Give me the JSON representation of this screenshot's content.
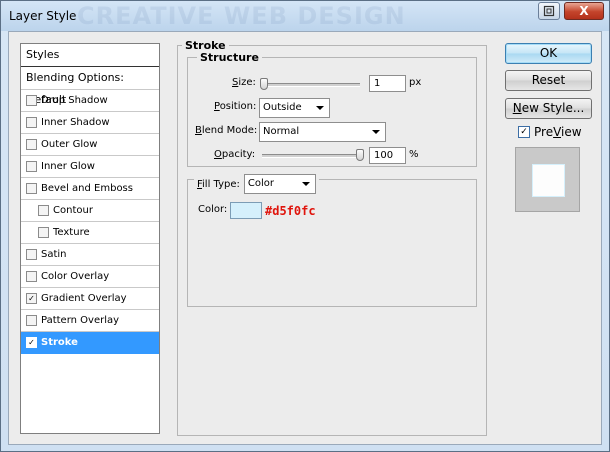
{
  "window": {
    "title": "Layer Style",
    "watermark": "CREATIVE WEB DESIGN",
    "help_glyph": "?",
    "close_glyph": "X"
  },
  "styles_list": {
    "header": "Styles",
    "blending": "Blending Options: Default",
    "items": [
      {
        "label": "Drop Shadow",
        "checked": false
      },
      {
        "label": "Inner Shadow",
        "checked": false
      },
      {
        "label": "Outer Glow",
        "checked": false
      },
      {
        "label": "Inner Glow",
        "checked": false
      },
      {
        "label": "Bevel and Emboss",
        "checked": false
      },
      {
        "label": "Contour",
        "checked": false,
        "sub": true
      },
      {
        "label": "Texture",
        "checked": false,
        "sub": true
      },
      {
        "label": "Satin",
        "checked": false
      },
      {
        "label": "Color Overlay",
        "checked": false
      },
      {
        "label": "Gradient Overlay",
        "checked": true
      },
      {
        "label": "Pattern Overlay",
        "checked": false
      },
      {
        "label": "Stroke",
        "checked": true,
        "selected": true
      }
    ]
  },
  "stroke": {
    "section_title": "Stroke",
    "structure_title": "Structure",
    "size_label_u": "S",
    "size_label_rest": "ize:",
    "size_value": "1",
    "size_unit": "px",
    "size_level": 0.0,
    "position_label_u": "P",
    "position_label_rest": "osition:",
    "position_value": "Outside",
    "blend_label_u": "B",
    "blend_label_rest": "lend Mode:",
    "blend_value": "Normal",
    "opacity_label_u": "O",
    "opacity_label_rest": "pacity:",
    "opacity_value": "100",
    "opacity_unit": "%",
    "opacity_level": 1.0,
    "fill_label_u": "F",
    "fill_label_rest": "ill Type:",
    "fill_value": "Color",
    "color_label": "Color:",
    "color_hex": "#d5f0fc",
    "annotation_color": "#e0140c"
  },
  "buttons": {
    "ok": "OK",
    "reset": "Reset",
    "new_style_u": "N",
    "new_style_rest": "ew Style...",
    "preview_label_u": "V",
    "preview_label_pre": "Pre",
    "preview_label_post": "iew",
    "preview_checked": true
  },
  "check_glyph": "✓"
}
